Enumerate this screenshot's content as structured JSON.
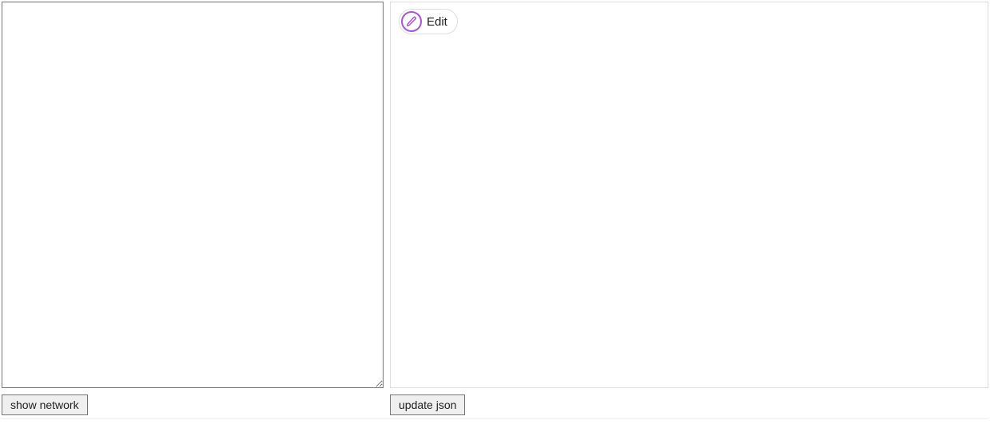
{
  "left": {
    "textarea_value": "",
    "show_network_label": "show network"
  },
  "right": {
    "edit_label": "Edit",
    "update_json_label": "update json"
  },
  "colors": {
    "accent_purple": "#a855d6"
  }
}
